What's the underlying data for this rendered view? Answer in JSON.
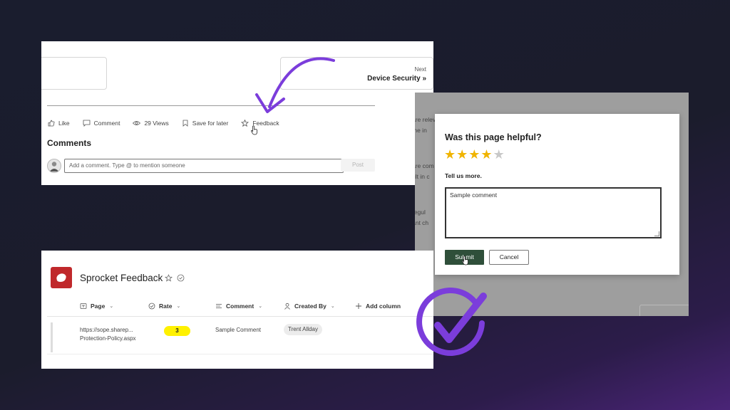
{
  "article": {
    "next_label": "Next",
    "next_title": "Device Security »",
    "actions": [
      {
        "icon": "thumbs-up-icon",
        "label": "Like"
      },
      {
        "icon": "comment-icon",
        "label": "Comment"
      },
      {
        "icon": "eye-icon",
        "label": "29 Views"
      },
      {
        "icon": "bookmark-icon",
        "label": "Save for later"
      },
      {
        "icon": "star-outline-icon",
        "label": "Feedback"
      }
    ],
    "comments_title": "Comments",
    "comment_placeholder": "Add a comment. Type @ to mention someone",
    "post_label": "Post"
  },
  "background_text": [
    "are relev",
    "the in",
    "are com",
    "ult in c",
    "regul",
    "ant ch"
  ],
  "dialog": {
    "title": "Was this page helpful?",
    "rating": 4,
    "max_rating": 5,
    "tell_more": "Tell us more.",
    "comment_value": "Sample comment",
    "submit_label": "Submit",
    "cancel_label": "Cancel",
    "colors": {
      "star_filled": "#f0b400",
      "star_empty": "#c8c8c8",
      "submit_bg": "#2f4f3a"
    }
  },
  "list": {
    "title": "Sprocket Feedback",
    "columns": [
      {
        "icon": "page-icon",
        "label": "Page"
      },
      {
        "icon": "check-circle-icon",
        "label": "Rate"
      },
      {
        "icon": "text-lines-icon",
        "label": "Comment"
      },
      {
        "icon": "person-icon",
        "label": "Created By"
      },
      {
        "icon": "plus-icon",
        "label": "Add column"
      }
    ],
    "rows": [
      {
        "page": "https://sope.sharep... Protection-Policy.aspx",
        "rate": "3",
        "comment": "Sample Comment",
        "created_by": "Trent Allday"
      }
    ],
    "colors": {
      "rate_badge": "#fff100",
      "list_icon": "#c0282b"
    }
  },
  "decorations": {
    "arrow_color": "#7b3ddb",
    "check_color": "#7b3ddb"
  }
}
